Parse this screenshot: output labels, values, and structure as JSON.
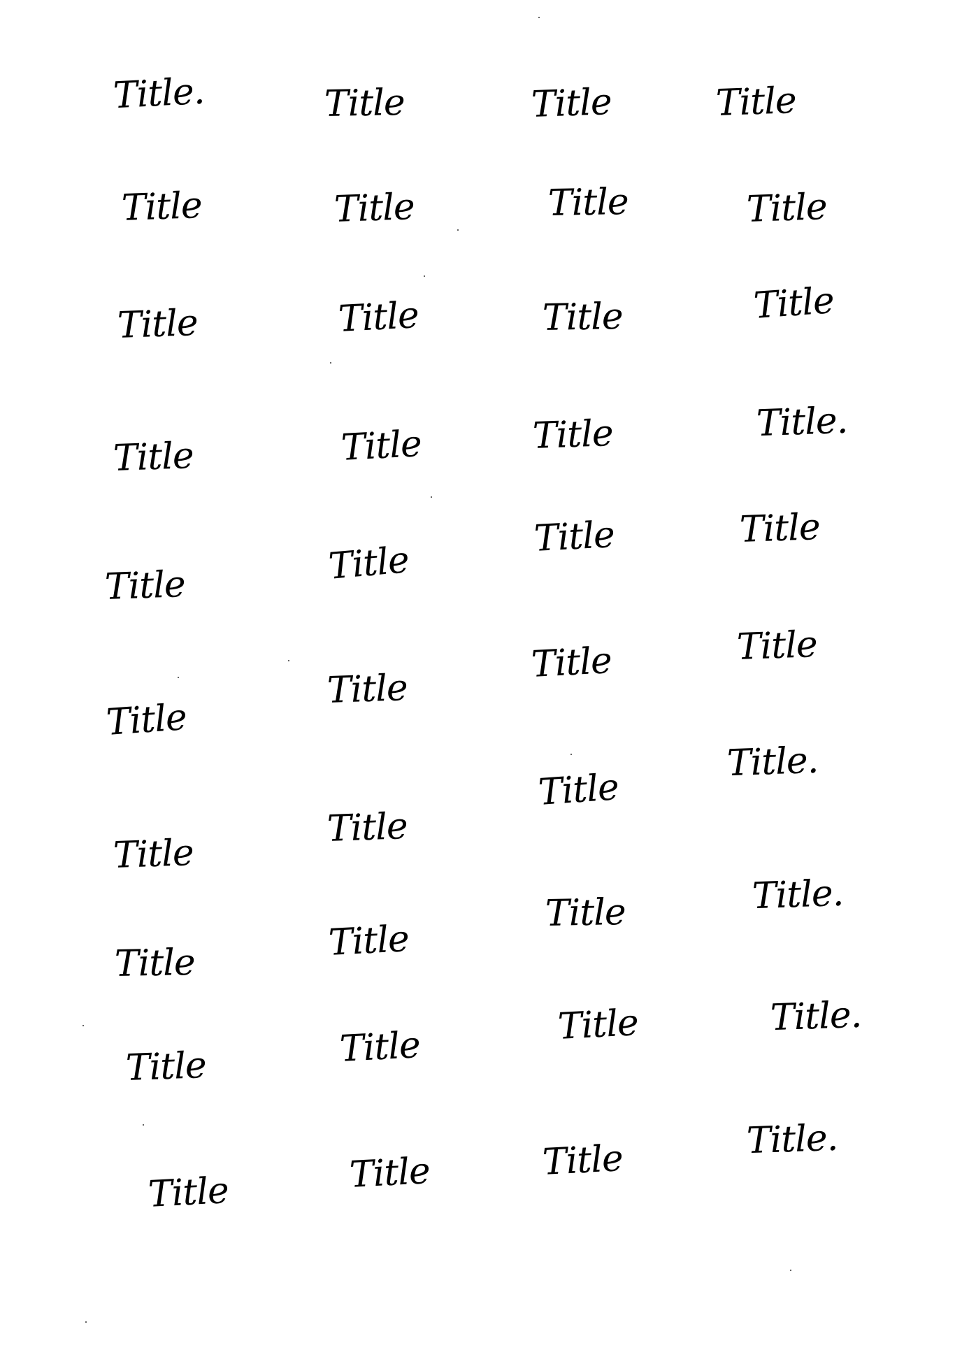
{
  "sheet": {
    "words": [
      [
        "Title.",
        "Title",
        "Title",
        "Title"
      ],
      [
        "Title",
        "Title",
        "Title",
        "Title"
      ],
      [
        "Title",
        "Title",
        "Title",
        "Title"
      ],
      [
        "Title",
        "Title",
        "Title",
        "Title."
      ],
      [
        "Title",
        "Title",
        "Title",
        "Title"
      ],
      [
        "Title",
        "Title",
        "Title",
        "Title"
      ],
      [
        "Title",
        "Title",
        "Title",
        "Title."
      ],
      [
        "Title",
        "Title",
        "Title",
        "Title."
      ],
      [
        "Title",
        "Title",
        "Title",
        "Title."
      ],
      [
        "Title",
        "Title",
        "Title",
        "Title."
      ]
    ],
    "ink_color": "#000000",
    "paper_color": "#ffffff"
  }
}
